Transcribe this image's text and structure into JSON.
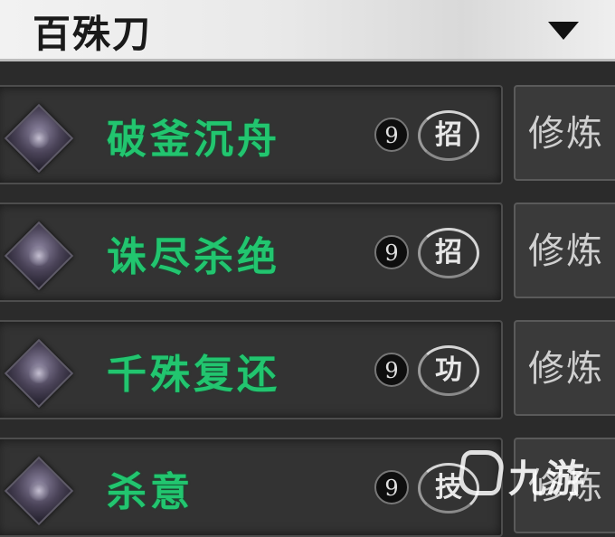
{
  "header": {
    "title": "百殊刀",
    "dropdown_icon": "caret-down-icon"
  },
  "skills": [
    {
      "name": "破釜沉舟",
      "ear": "9",
      "type": "招",
      "action": "修炼",
      "icon": "blade-skill-icon"
    },
    {
      "name": "诛尽杀绝",
      "ear": "9",
      "type": "招",
      "action": "修炼",
      "icon": "slash-skill-icon"
    },
    {
      "name": "千殊复还",
      "ear": "9",
      "type": "功",
      "action": "修炼",
      "icon": "return-skill-icon"
    },
    {
      "name": "杀意",
      "ear": "9",
      "type": "技",
      "action": "修炼",
      "icon": "intent-skill-icon"
    }
  ],
  "colors": {
    "skill_name": "#22c56f",
    "header_bg": "#ebebeb",
    "panel_bg": "#333333"
  },
  "watermark": {
    "text": "九游"
  }
}
